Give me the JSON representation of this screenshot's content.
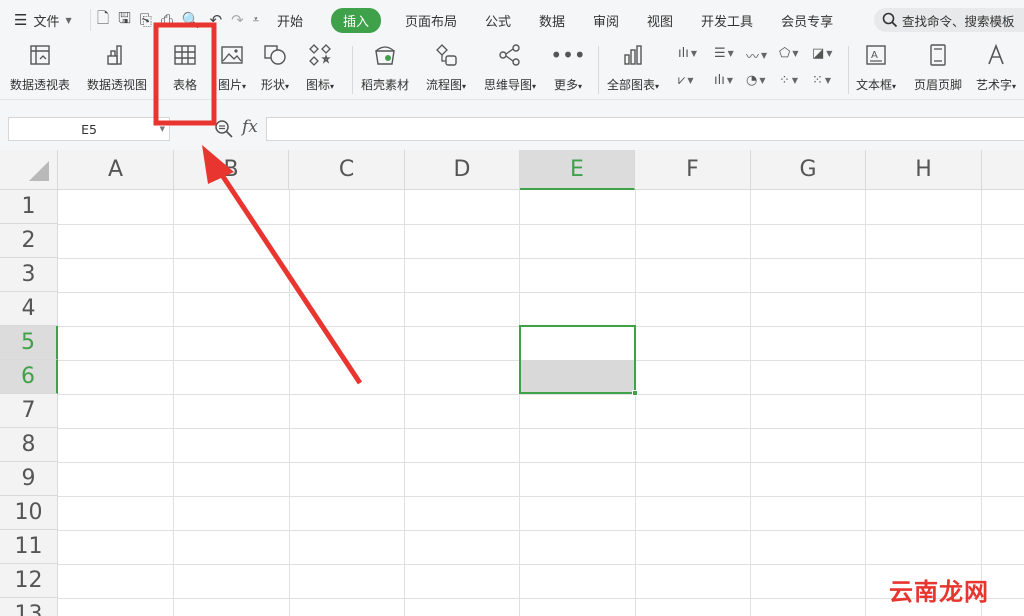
{
  "topbar": {
    "menu_label": "文件",
    "tabs": [
      "开始",
      "插入",
      "页面布局",
      "公式",
      "数据",
      "审阅",
      "视图",
      "开发工具",
      "会员专享"
    ],
    "active_tab": "插入",
    "search_placeholder": "查找命令、搜索模板"
  },
  "ribbon": {
    "pivot_table": "数据透视表",
    "pivot_chart": "数据透视图",
    "table": "表格",
    "picture": "图片",
    "shape": "形状",
    "icon": "图标",
    "material": "稻壳素材",
    "flowchart": "流程图",
    "mindmap": "思维导图",
    "more": "更多",
    "all_charts": "全部图表",
    "textbox": "文本框",
    "header_footer": "页眉页脚",
    "wordart": "艺术字"
  },
  "formula_bar": {
    "cell_ref": "E5",
    "fx": "fx",
    "value": ""
  },
  "sheet": {
    "columns": [
      "A",
      "B",
      "C",
      "D",
      "E",
      "F",
      "G",
      "H"
    ],
    "rows": [
      "1",
      "2",
      "3",
      "4",
      "5",
      "6",
      "7",
      "8",
      "9",
      "10",
      "11",
      "12",
      "13"
    ],
    "selected_column": "E",
    "selected_rows": [
      "5",
      "6"
    ]
  },
  "watermark": "云南龙网",
  "colors": {
    "accent": "#3fa14a",
    "annotation": "#e8352f"
  }
}
